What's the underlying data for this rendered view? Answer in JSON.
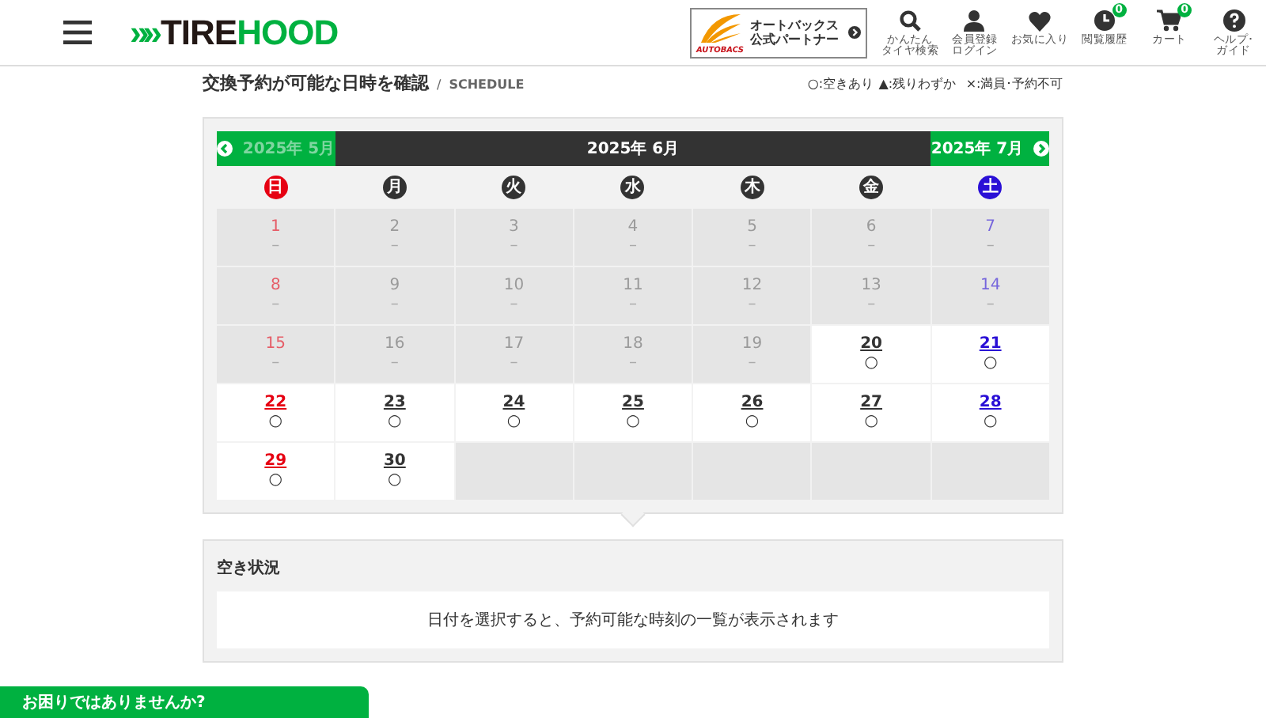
{
  "header": {
    "logo": {
      "mark": "»",
      "text_dark": "TIRE",
      "text_green": "HOOD"
    },
    "partner": {
      "logo_text": "AUTOBACS",
      "line1": "オートバックス",
      "line2": "公式パートナー"
    },
    "nav": [
      {
        "lines": [
          "かんたん",
          "タイヤ検索"
        ]
      },
      {
        "lines": [
          "会員登録",
          "ログイン"
        ]
      },
      {
        "lines": [
          "お気に入り"
        ]
      },
      {
        "lines": [
          "閲覧履歴"
        ],
        "badge": "0"
      },
      {
        "lines": [
          "カート"
        ],
        "badge": "0"
      },
      {
        "lines": [
          "ヘルプ･",
          "ガイド"
        ]
      }
    ]
  },
  "page_title": {
    "title": "交換予約が可能な日時を確認",
    "separator": "/",
    "subtitle": "SCHEDULE"
  },
  "legend": [
    "○:空きあり",
    "▲:残りわずか",
    "×:満員･予約不可"
  ],
  "calendar": {
    "prev": "2025年 5月",
    "prev_disabled": true,
    "current": "2025年 6月",
    "next": "2025年 7月",
    "weekdays": [
      {
        "label": "日",
        "color": "#e60012"
      },
      {
        "label": "月",
        "color": "#333333"
      },
      {
        "label": "火",
        "color": "#333333"
      },
      {
        "label": "水",
        "color": "#333333"
      },
      {
        "label": "木",
        "color": "#333333"
      },
      {
        "label": "金",
        "color": "#333333"
      },
      {
        "label": "土",
        "color": "#2a0fd6"
      }
    ],
    "days": [
      {
        "number": "1",
        "mark": "–",
        "available": false
      },
      {
        "number": "2",
        "mark": "–",
        "available": false
      },
      {
        "number": "3",
        "mark": "–",
        "available": false
      },
      {
        "number": "4",
        "mark": "–",
        "available": false
      },
      {
        "number": "5",
        "mark": "–",
        "available": false
      },
      {
        "number": "6",
        "mark": "–",
        "available": false
      },
      {
        "number": "7",
        "mark": "–",
        "available": false
      },
      {
        "number": "8",
        "mark": "–",
        "available": false
      },
      {
        "number": "9",
        "mark": "–",
        "available": false
      },
      {
        "number": "10",
        "mark": "–",
        "available": false
      },
      {
        "number": "11",
        "mark": "–",
        "available": false
      },
      {
        "number": "12",
        "mark": "–",
        "available": false
      },
      {
        "number": "13",
        "mark": "–",
        "available": false
      },
      {
        "number": "14",
        "mark": "–",
        "available": false
      },
      {
        "number": "15",
        "mark": "–",
        "available": false
      },
      {
        "number": "16",
        "mark": "–",
        "available": false
      },
      {
        "number": "17",
        "mark": "–",
        "available": false
      },
      {
        "number": "18",
        "mark": "–",
        "available": false
      },
      {
        "number": "19",
        "mark": "–",
        "available": false
      },
      {
        "number": "20",
        "mark": "○",
        "available": true
      },
      {
        "number": "21",
        "mark": "○",
        "available": true
      },
      {
        "number": "22",
        "mark": "○",
        "available": true
      },
      {
        "number": "23",
        "mark": "○",
        "available": true
      },
      {
        "number": "24",
        "mark": "○",
        "available": true
      },
      {
        "number": "25",
        "mark": "○",
        "available": true
      },
      {
        "number": "26",
        "mark": "○",
        "available": true
      },
      {
        "number": "27",
        "mark": "○",
        "available": true
      },
      {
        "number": "28",
        "mark": "○",
        "available": true
      },
      {
        "number": "29",
        "mark": "○",
        "available": true
      },
      {
        "number": "30",
        "mark": "○",
        "available": true
      }
    ]
  },
  "availability": {
    "title": "空き状況",
    "message": "日付を選択すると、予約可能な時刻の一覧が表示されます"
  },
  "help_tab": "お困りではありませんか?"
}
